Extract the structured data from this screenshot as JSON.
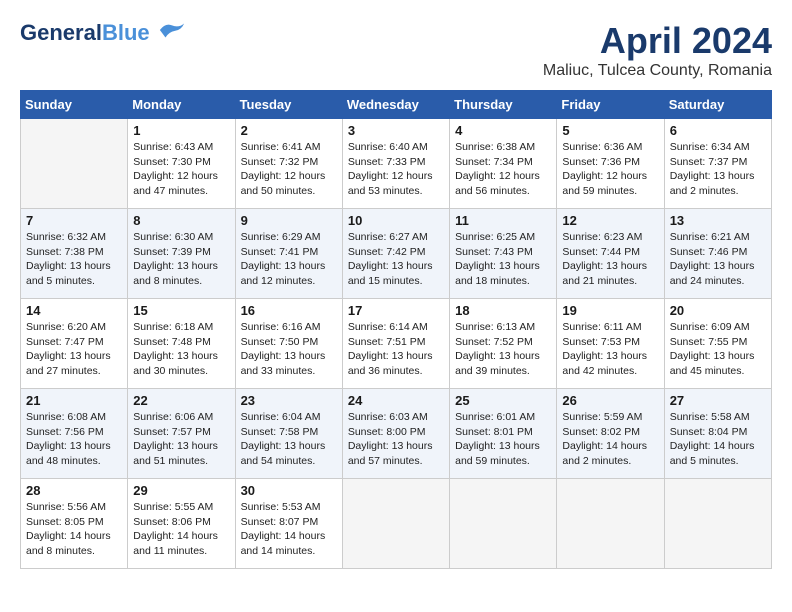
{
  "header": {
    "logo_line1": "General",
    "logo_line2": "Blue",
    "title": "April 2024",
    "subtitle": "Maliuc, Tulcea County, Romania"
  },
  "weekdays": [
    "Sunday",
    "Monday",
    "Tuesday",
    "Wednesday",
    "Thursday",
    "Friday",
    "Saturday"
  ],
  "weeks": [
    [
      {
        "day": "",
        "info": ""
      },
      {
        "day": "1",
        "info": "Sunrise: 6:43 AM\nSunset: 7:30 PM\nDaylight: 12 hours\nand 47 minutes."
      },
      {
        "day": "2",
        "info": "Sunrise: 6:41 AM\nSunset: 7:32 PM\nDaylight: 12 hours\nand 50 minutes."
      },
      {
        "day": "3",
        "info": "Sunrise: 6:40 AM\nSunset: 7:33 PM\nDaylight: 12 hours\nand 53 minutes."
      },
      {
        "day": "4",
        "info": "Sunrise: 6:38 AM\nSunset: 7:34 PM\nDaylight: 12 hours\nand 56 minutes."
      },
      {
        "day": "5",
        "info": "Sunrise: 6:36 AM\nSunset: 7:36 PM\nDaylight: 12 hours\nand 59 minutes."
      },
      {
        "day": "6",
        "info": "Sunrise: 6:34 AM\nSunset: 7:37 PM\nDaylight: 13 hours\nand 2 minutes."
      }
    ],
    [
      {
        "day": "7",
        "info": "Sunrise: 6:32 AM\nSunset: 7:38 PM\nDaylight: 13 hours\nand 5 minutes."
      },
      {
        "day": "8",
        "info": "Sunrise: 6:30 AM\nSunset: 7:39 PM\nDaylight: 13 hours\nand 8 minutes."
      },
      {
        "day": "9",
        "info": "Sunrise: 6:29 AM\nSunset: 7:41 PM\nDaylight: 13 hours\nand 12 minutes."
      },
      {
        "day": "10",
        "info": "Sunrise: 6:27 AM\nSunset: 7:42 PM\nDaylight: 13 hours\nand 15 minutes."
      },
      {
        "day": "11",
        "info": "Sunrise: 6:25 AM\nSunset: 7:43 PM\nDaylight: 13 hours\nand 18 minutes."
      },
      {
        "day": "12",
        "info": "Sunrise: 6:23 AM\nSunset: 7:44 PM\nDaylight: 13 hours\nand 21 minutes."
      },
      {
        "day": "13",
        "info": "Sunrise: 6:21 AM\nSunset: 7:46 PM\nDaylight: 13 hours\nand 24 minutes."
      }
    ],
    [
      {
        "day": "14",
        "info": "Sunrise: 6:20 AM\nSunset: 7:47 PM\nDaylight: 13 hours\nand 27 minutes."
      },
      {
        "day": "15",
        "info": "Sunrise: 6:18 AM\nSunset: 7:48 PM\nDaylight: 13 hours\nand 30 minutes."
      },
      {
        "day": "16",
        "info": "Sunrise: 6:16 AM\nSunset: 7:50 PM\nDaylight: 13 hours\nand 33 minutes."
      },
      {
        "day": "17",
        "info": "Sunrise: 6:14 AM\nSunset: 7:51 PM\nDaylight: 13 hours\nand 36 minutes."
      },
      {
        "day": "18",
        "info": "Sunrise: 6:13 AM\nSunset: 7:52 PM\nDaylight: 13 hours\nand 39 minutes."
      },
      {
        "day": "19",
        "info": "Sunrise: 6:11 AM\nSunset: 7:53 PM\nDaylight: 13 hours\nand 42 minutes."
      },
      {
        "day": "20",
        "info": "Sunrise: 6:09 AM\nSunset: 7:55 PM\nDaylight: 13 hours\nand 45 minutes."
      }
    ],
    [
      {
        "day": "21",
        "info": "Sunrise: 6:08 AM\nSunset: 7:56 PM\nDaylight: 13 hours\nand 48 minutes."
      },
      {
        "day": "22",
        "info": "Sunrise: 6:06 AM\nSunset: 7:57 PM\nDaylight: 13 hours\nand 51 minutes."
      },
      {
        "day": "23",
        "info": "Sunrise: 6:04 AM\nSunset: 7:58 PM\nDaylight: 13 hours\nand 54 minutes."
      },
      {
        "day": "24",
        "info": "Sunrise: 6:03 AM\nSunset: 8:00 PM\nDaylight: 13 hours\nand 57 minutes."
      },
      {
        "day": "25",
        "info": "Sunrise: 6:01 AM\nSunset: 8:01 PM\nDaylight: 13 hours\nand 59 minutes."
      },
      {
        "day": "26",
        "info": "Sunrise: 5:59 AM\nSunset: 8:02 PM\nDaylight: 14 hours\nand 2 minutes."
      },
      {
        "day": "27",
        "info": "Sunrise: 5:58 AM\nSunset: 8:04 PM\nDaylight: 14 hours\nand 5 minutes."
      }
    ],
    [
      {
        "day": "28",
        "info": "Sunrise: 5:56 AM\nSunset: 8:05 PM\nDaylight: 14 hours\nand 8 minutes."
      },
      {
        "day": "29",
        "info": "Sunrise: 5:55 AM\nSunset: 8:06 PM\nDaylight: 14 hours\nand 11 minutes."
      },
      {
        "day": "30",
        "info": "Sunrise: 5:53 AM\nSunset: 8:07 PM\nDaylight: 14 hours\nand 14 minutes."
      },
      {
        "day": "",
        "info": ""
      },
      {
        "day": "",
        "info": ""
      },
      {
        "day": "",
        "info": ""
      },
      {
        "day": "",
        "info": ""
      }
    ]
  ]
}
